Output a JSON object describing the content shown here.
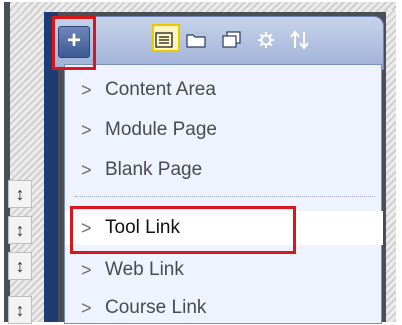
{
  "toolbar": {
    "add_button_label": "+",
    "icons": [
      "list-icon",
      "folder-icon",
      "pages-icon",
      "gear-icon",
      "sort-icon"
    ]
  },
  "menu": {
    "items": [
      {
        "label": "Content Area"
      },
      {
        "label": "Module Page"
      },
      {
        "label": "Blank Page"
      },
      {
        "label": "Tool Link"
      },
      {
        "label": "Web Link"
      },
      {
        "label": "Course Link"
      }
    ],
    "chevron": ">"
  },
  "handles": {
    "glyph": "↕"
  },
  "colors": {
    "highlight_outline": "#d9161b",
    "menu_bg": "#eef3ff",
    "nav_strip": "#1f3b73"
  }
}
